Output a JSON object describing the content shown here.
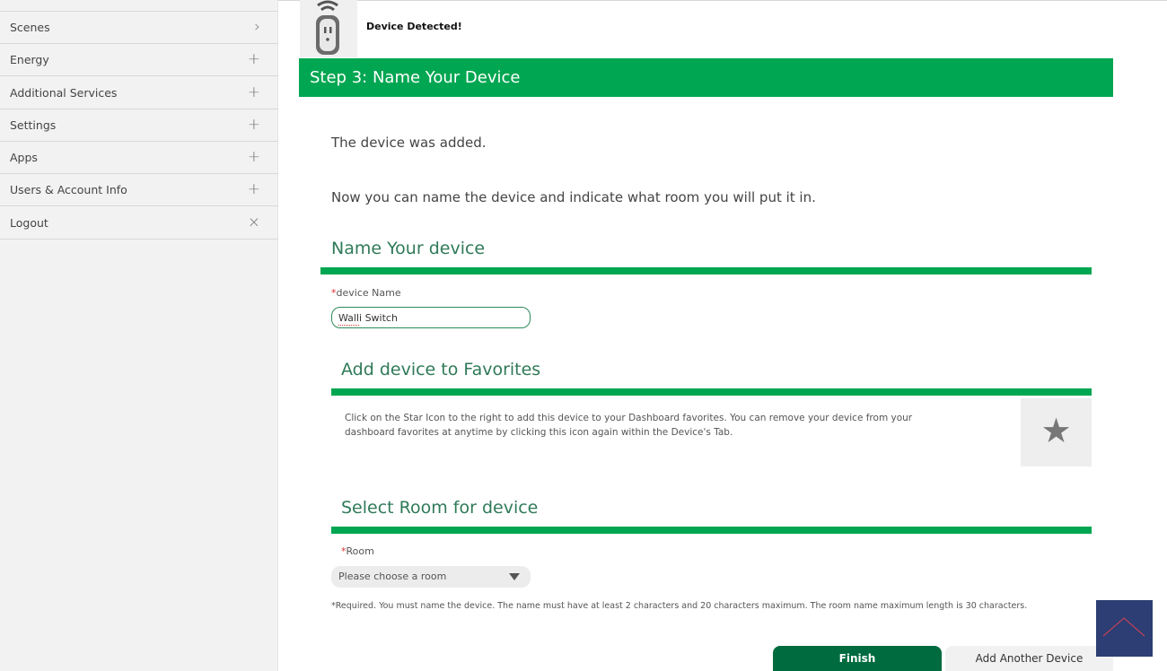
{
  "sidebar": {
    "items": [
      {
        "label": "Scenes",
        "symbol": "›"
      },
      {
        "label": "Energy",
        "symbol": "+"
      },
      {
        "label": "Additional Services",
        "symbol": "+"
      },
      {
        "label": "Settings",
        "symbol": "+"
      },
      {
        "label": "Apps",
        "symbol": "+"
      },
      {
        "label": "Users & Account Info",
        "symbol": "+"
      },
      {
        "label": "Logout",
        "symbol": "×"
      }
    ]
  },
  "detection": {
    "message": "Device Detected!",
    "icon": "plug-wifi-icon"
  },
  "step": {
    "title": "Step 3: Name Your Device"
  },
  "intro": {
    "added": "The device was added.",
    "instruction": "Now you can name the device and indicate what room you will put it in."
  },
  "name_section": {
    "title": "Name Your device",
    "required_mark": "*",
    "field_label": "device Name",
    "value": "Walli Switch"
  },
  "favorites_section": {
    "title": "Add device to Favorites",
    "description": "Click on the Star Icon to the right to add this device to your Dashboard favorites. You can remove your device from your dashboard favorites at anytime by clicking this icon again within the Device's Tab.",
    "star_icon": "★"
  },
  "room_section": {
    "title": "Select Room for device",
    "required_mark": "*",
    "field_label": "Room",
    "selected": "Please choose a room"
  },
  "required_note": "*Required. You must name the device. The name must have at least 2 characters and 20 characters maximum. The room name maximum length is 30 characters.",
  "buttons": {
    "finish": "Finish",
    "add_another": "Add Another Device"
  },
  "colors": {
    "brand_green": "#00a651",
    "dark_green": "#006b3f",
    "scroll_button": "#2c3e73"
  }
}
